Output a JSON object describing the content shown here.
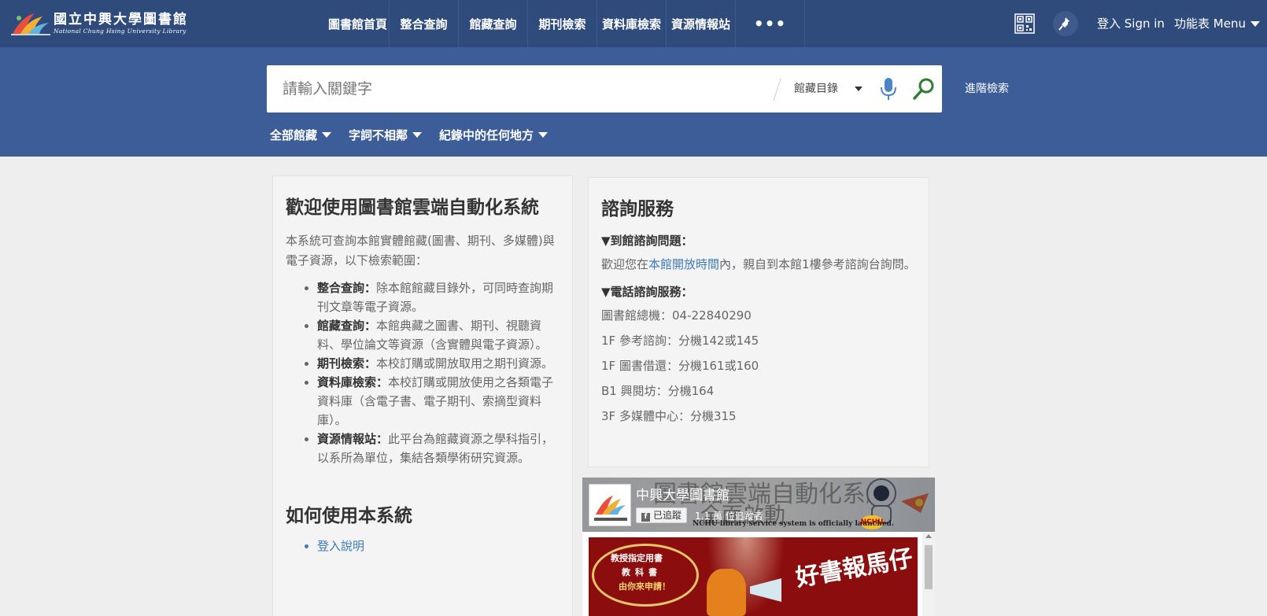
{
  "header": {
    "logo_cn": "國立中興大學圖書館",
    "logo_en": "National Chung Hsing University Library",
    "nav": [
      {
        "label": "圖書館首頁",
        "name": "nav-home"
      },
      {
        "label": "整合查詢",
        "name": "nav-integrated-search"
      },
      {
        "label": "館藏查詢",
        "name": "nav-catalog-search"
      },
      {
        "label": "期刊檢索",
        "name": "nav-journal-search"
      },
      {
        "label": "資料庫檢索",
        "name": "nav-database-search"
      },
      {
        "label": "資源情報站",
        "name": "nav-resource-station"
      }
    ],
    "more_label": "•••",
    "signin_label": "登入 Sign in",
    "menu_label": "功能表 Menu",
    "accent": "#2f4b7c"
  },
  "search": {
    "placeholder": "請輸入關鍵字",
    "value": "",
    "scope": "館藏目錄",
    "advanced_label": "進階檢索",
    "filters": [
      "全部館藏",
      "字詞不相鄰",
      "紀錄中的任何地方"
    ],
    "band_color": "#3d5d99"
  },
  "welcome": {
    "title": "歡迎使用圖書館雲端自動化系統",
    "intro": "本系統可查詢本館實體館藏(圖書、期刊、多媒體)與電子資源，以下檢索範圍：",
    "features": [
      {
        "term": "整合查詢：",
        "desc": "除本館館藏目錄外，可同時查詢期刊文章等電子資源。"
      },
      {
        "term": "館藏查詢：",
        "desc": "本館典藏之圖書、期刊、視聽資料、學位論文等資源（含實體與電子資源）。"
      },
      {
        "term": "期刊檢索：",
        "desc": "本校訂購或開放取用之期刊資源。"
      },
      {
        "term": "資料庫檢索：",
        "desc": "本校訂購或開放使用之各類電子資料庫（含電子書、電子期刊、索摘型資料庫）。"
      },
      {
        "term": "資源情報站：",
        "desc": "此平台為館藏資源之學科指引，以系所為單位，集結各類學術研究資源。"
      }
    ],
    "howto_title": "如何使用本系統",
    "howto_links": [
      "登入說明"
    ]
  },
  "consult": {
    "title": "諮詢服務",
    "onsite_heading": "▼到館諮詢問題：",
    "onsite_text_pre": "歡迎您在",
    "onsite_link": "本館開放時間",
    "onsite_text_post": "內，親自到本館1樓參考諮詢台詢問。",
    "phone_heading": "▼電話諮詢服務：",
    "phones": [
      "圖書館總機：04-22840290",
      "1F 參考諮詢：分機142或145",
      "1F 圖書借還：分機161或160",
      "B1 興閱坊：分機164",
      "3F 多媒體中心：分機315"
    ]
  },
  "facebook": {
    "cover_text": "圖書館雲端自動化系統",
    "cover_text2": "全面啟動",
    "page_name": "中興大學圖書館",
    "follow_label": "已追蹤",
    "followers": "1.1 萬 位追蹤者",
    "announcement": "NCHU library service system is officially launched.",
    "badge": "NCHU",
    "post_line1": "教授指定用書",
    "post_line2": "教科書",
    "post_line3": "由你來申請！",
    "post_big": "好書報馬仔"
  }
}
